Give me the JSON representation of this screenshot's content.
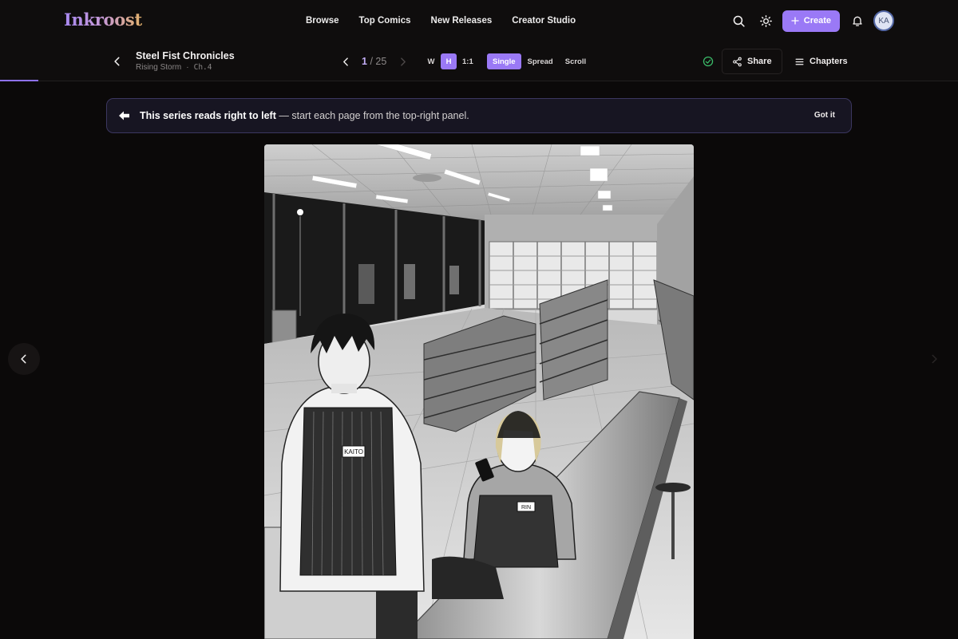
{
  "app": {
    "name": "Inkroost"
  },
  "nav": {
    "links": [
      "Browse",
      "Top Comics",
      "New Releases",
      "Creator Studio"
    ],
    "create_label": "Create",
    "avatar_initials": "KA",
    "accent_color": "#9a79f6"
  },
  "reader": {
    "series_title": "Steel Fist Chronicles",
    "series_subtitle": "Rising Storm",
    "chapter": "Ch.4",
    "page_current": "1",
    "page_separator": "/",
    "page_total": "25",
    "fit_options": [
      "W",
      "H",
      "1:1"
    ],
    "fit_selected": "H",
    "mode_options": [
      "Single",
      "Spread",
      "Scroll"
    ],
    "mode_selected": "Single",
    "share_label": "Share",
    "chapters_label": "Chapters",
    "saved_status_icon": "check-circle-icon"
  },
  "notice": {
    "bold_text": "This series reads right to left",
    "rest_text": "— start each page from the top-right panel.",
    "dismiss_label": "Got it"
  },
  "page_art": {
    "description_labels": [
      "KAITO",
      "RIN"
    ]
  }
}
